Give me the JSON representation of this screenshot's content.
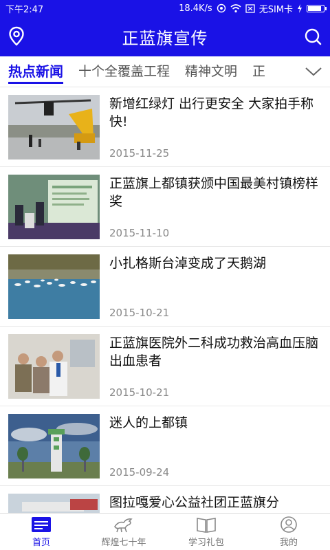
{
  "status": {
    "time": "下午2:47",
    "speed": "18.4K/s",
    "sim": "无SIM卡",
    "battery_level": 0.9
  },
  "header": {
    "title": "正蓝旗宣传"
  },
  "tabs": [
    {
      "label": "热点新闻"
    },
    {
      "label": "十个全覆盖工程"
    },
    {
      "label": "精神文明"
    },
    {
      "label": "正"
    }
  ],
  "news": [
    {
      "title": "新增红绿灯 出行更安全 大家拍手称快!",
      "date": "2015-11-25"
    },
    {
      "title": "正蓝旗上都镇获颁中国最美村镇榜样奖",
      "date": "2015-11-10"
    },
    {
      "title": "小扎格斯台淖变成了天鹅湖",
      "date": "2015-10-21"
    },
    {
      "title": "正蓝旗医院外二科成功救治高血压脑出血患者",
      "date": "2015-10-21"
    },
    {
      "title": "迷人的上都镇",
      "date": "2015-09-24"
    },
    {
      "title": "图拉嘎爱心公益社团正蓝旗分",
      "date": ""
    }
  ],
  "nav": [
    {
      "label": "首页"
    },
    {
      "label": "辉煌七十年"
    },
    {
      "label": "学习礼包"
    },
    {
      "label": "我的"
    }
  ],
  "colors": {
    "primary": "#1a12e6"
  }
}
